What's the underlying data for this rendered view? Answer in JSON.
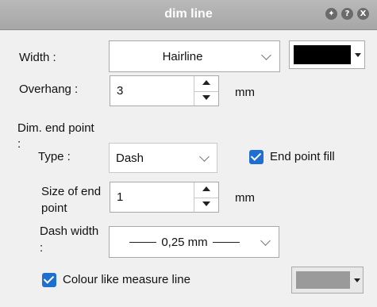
{
  "window": {
    "title": "dim line",
    "buttons": [
      {
        "name": "pin-icon",
        "glyph": "✦"
      },
      {
        "name": "help-icon",
        "glyph": "?"
      },
      {
        "name": "close-icon",
        "glyph": "X"
      }
    ]
  },
  "width": {
    "label": "Width :",
    "value": "Hairline",
    "color": "#000000"
  },
  "overhang": {
    "label": "Overhang :",
    "value": "3",
    "unit": "mm"
  },
  "end_point": {
    "section_label": "Dim. end point :",
    "type_label": "Type :",
    "type_value": "Dash",
    "fill_label": "End point fill",
    "fill_checked": true,
    "size_label": "Size of end point",
    "size_value": "1",
    "size_unit": "mm",
    "dash_width_label": "Dash width :",
    "dash_width_value": "0,25 mm"
  },
  "colour_like": {
    "label": "Colour like measure line",
    "checked": true,
    "color": "#9a9a9a"
  }
}
